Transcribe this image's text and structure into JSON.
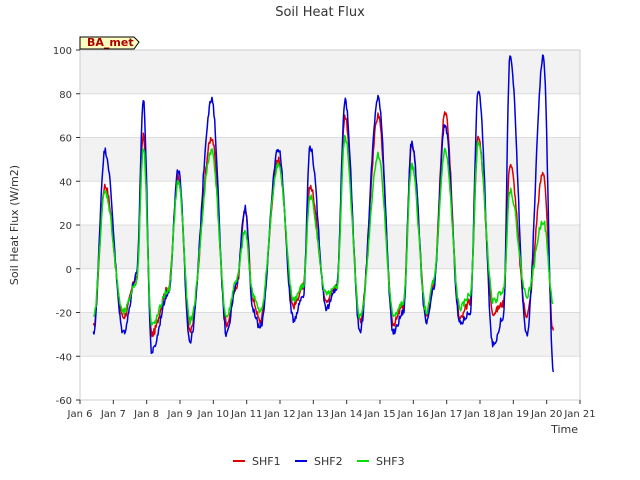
{
  "chart_data": {
    "type": "line",
    "title": "Soil Heat Flux",
    "xlabel": "Time",
    "ylabel": "Soil Heat Flux (W/m2)",
    "ylim": [
      -60,
      100
    ],
    "xlim": [
      6,
      21
    ],
    "yticks": [
      -60,
      -40,
      -20,
      0,
      20,
      40,
      60,
      80,
      100
    ],
    "xticks": [
      6,
      7,
      8,
      9,
      10,
      11,
      12,
      13,
      14,
      15,
      16,
      17,
      18,
      19,
      20,
      21
    ],
    "xtick_labels": [
      "Jan 6",
      "Jan 7",
      "Jan 8",
      "Jan 9",
      "Jan 10",
      "Jan 11",
      "Jan 12",
      "Jan 13",
      "Jan 14",
      "Jan 15",
      "Jan 16",
      "Jan 17",
      "Jan 18",
      "Jan 19",
      "Jan 20",
      "Jan 21"
    ],
    "grid": "horizontal bands",
    "legend_position": "bottom",
    "annotation": "BA_met",
    "series": [
      {
        "name": "SHF1",
        "color": "#dd0000",
        "peaks": [
          [
            6.75,
            38
          ],
          [
            7.9,
            61
          ],
          [
            8.95,
            42
          ],
          [
            9.95,
            60
          ],
          [
            10.95,
            27
          ],
          [
            11.95,
            50
          ],
          [
            12.9,
            38
          ],
          [
            13.95,
            70
          ],
          [
            14.95,
            70
          ],
          [
            15.95,
            57
          ],
          [
            16.95,
            72
          ],
          [
            17.95,
            60
          ],
          [
            18.9,
            48
          ],
          [
            19.9,
            44
          ]
        ],
        "troughs": [
          [
            6.4,
            -27
          ],
          [
            7.3,
            -22
          ],
          [
            8.15,
            -30
          ],
          [
            9.3,
            -29
          ],
          [
            10.4,
            -25
          ],
          [
            11.4,
            -24
          ],
          [
            12.4,
            -17
          ],
          [
            13.4,
            -14
          ],
          [
            14.4,
            -24
          ],
          [
            15.4,
            -25
          ],
          [
            16.4,
            -22
          ],
          [
            17.4,
            -23
          ],
          [
            18.4,
            -20
          ],
          [
            19.4,
            -21
          ],
          [
            20.2,
            -29
          ]
        ],
        "mids": [
          [
            7.7,
            -4
          ],
          [
            8.65,
            -9
          ],
          [
            10.7,
            -8
          ],
          [
            11.2,
            -15
          ],
          [
            12.7,
            -8
          ],
          [
            13.7,
            -8
          ],
          [
            15.7,
            -17
          ],
          [
            16.6,
            -7
          ],
          [
            17.7,
            -15
          ],
          [
            18.7,
            -16
          ]
        ]
      },
      {
        "name": "SHF2",
        "color": "#0000dd",
        "peaks": [
          [
            6.75,
            54
          ],
          [
            7.9,
            77
          ],
          [
            8.95,
            45
          ],
          [
            9.95,
            77
          ],
          [
            10.95,
            28
          ],
          [
            11.95,
            55
          ],
          [
            12.9,
            56
          ],
          [
            13.95,
            77
          ],
          [
            14.95,
            78
          ],
          [
            15.95,
            58
          ],
          [
            16.95,
            66
          ],
          [
            17.95,
            82
          ],
          [
            18.9,
            97
          ],
          [
            19.9,
            97
          ]
        ],
        "troughs": [
          [
            6.4,
            -30
          ],
          [
            7.3,
            -29
          ],
          [
            8.15,
            -38
          ],
          [
            9.3,
            -33
          ],
          [
            10.4,
            -30
          ],
          [
            11.4,
            -27
          ],
          [
            12.4,
            -23
          ],
          [
            13.4,
            -18
          ],
          [
            14.4,
            -28
          ],
          [
            15.4,
            -29
          ],
          [
            16.4,
            -25
          ],
          [
            17.4,
            -25
          ],
          [
            18.4,
            -35
          ],
          [
            19.4,
            -30
          ],
          [
            20.2,
            -46
          ]
        ],
        "mids": [
          [
            7.7,
            -3
          ],
          [
            8.65,
            -11
          ],
          [
            10.7,
            -6
          ],
          [
            11.2,
            -20
          ],
          [
            12.7,
            -12
          ],
          [
            13.7,
            -9
          ],
          [
            15.7,
            -20
          ],
          [
            16.6,
            -10
          ],
          [
            17.7,
            -20
          ],
          [
            18.7,
            -22
          ]
        ]
      },
      {
        "name": "SHF3",
        "color": "#00dd00",
        "peaks": [
          [
            6.75,
            35
          ],
          [
            7.9,
            56
          ],
          [
            8.95,
            40
          ],
          [
            9.95,
            54
          ],
          [
            10.95,
            17
          ],
          [
            11.95,
            48
          ],
          [
            12.9,
            33
          ],
          [
            13.95,
            60
          ],
          [
            14.95,
            52
          ],
          [
            15.95,
            47
          ],
          [
            16.95,
            54
          ],
          [
            17.95,
            58
          ],
          [
            18.9,
            36
          ],
          [
            19.9,
            22
          ]
        ],
        "troughs": [
          [
            6.4,
            -23
          ],
          [
            7.3,
            -20
          ],
          [
            8.15,
            -26
          ],
          [
            9.3,
            -24
          ],
          [
            10.4,
            -22
          ],
          [
            11.4,
            -20
          ],
          [
            12.4,
            -14
          ],
          [
            13.4,
            -12
          ],
          [
            14.4,
            -22
          ],
          [
            15.4,
            -21
          ],
          [
            16.4,
            -20
          ],
          [
            17.4,
            -18
          ],
          [
            18.4,
            -15
          ],
          [
            19.4,
            -12
          ],
          [
            20.2,
            -16
          ]
        ],
        "mids": [
          [
            7.7,
            -6
          ],
          [
            8.65,
            -10
          ],
          [
            10.7,
            -5
          ],
          [
            11.2,
            -12
          ],
          [
            12.7,
            -8
          ],
          [
            13.7,
            -9
          ],
          [
            15.7,
            -16
          ],
          [
            16.6,
            -6
          ],
          [
            17.7,
            -12
          ],
          [
            18.7,
            -10
          ]
        ]
      }
    ]
  }
}
